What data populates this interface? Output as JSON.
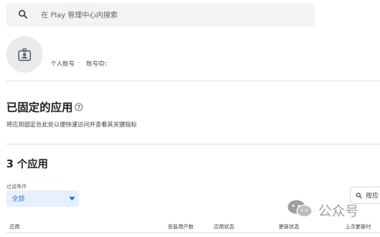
{
  "search": {
    "placeholder": "在 Play 管理中心内搜索"
  },
  "account": {
    "name_label": "个人账号",
    "separator": "·",
    "id_label": "账号ID："
  },
  "pinned": {
    "title": "已固定的应用",
    "description": "将应用固定在此处以便快速访问并查看其关键指标"
  },
  "apps": {
    "title": "3 个应用",
    "filter_label": "过滤条件",
    "filter_value": "全部",
    "search_button_label": "按应",
    "columns": [
      "应用",
      "安装用户数",
      "应用状态",
      "更新状态",
      "上次更新时"
    ]
  },
  "watermark": {
    "text": "公众号"
  },
  "colors": {
    "accent": "#1a73e8",
    "search_bg": "#f1f3f4",
    "filter_bg": "#e8f0fe",
    "divider": "#e0e0e0"
  },
  "icons": {
    "search": "search-icon",
    "avatar": "id-badge-icon",
    "help": "help-circle-icon",
    "caret": "caret-down-icon",
    "watermark": "wechat-logo-icon"
  }
}
